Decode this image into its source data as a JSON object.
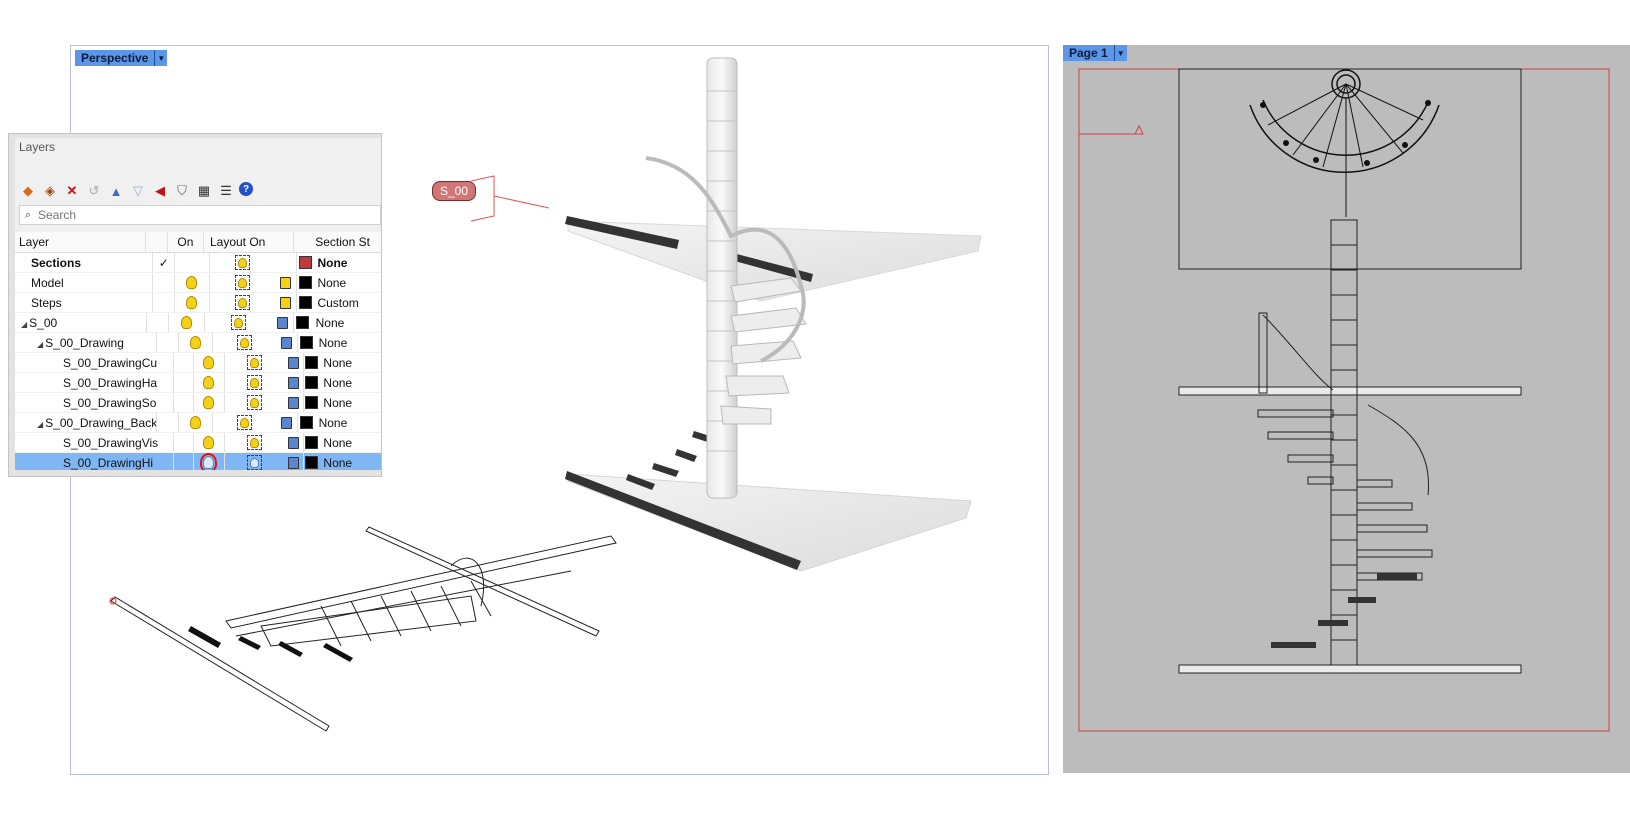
{
  "viewport": {
    "tab_label": "Perspective",
    "section_label": "S_00"
  },
  "layout": {
    "tab_label": "Page 1"
  },
  "layers_panel": {
    "title": "Layers",
    "search_placeholder": "Search",
    "columns": {
      "layer": "Layer",
      "on": "On",
      "layout_on": "Layout On",
      "section_style": "Section St"
    },
    "rows": [
      {
        "name": "Sections",
        "indent": 0,
        "bold": true,
        "current": true,
        "bulb": "none",
        "lock": "none",
        "color": "#c0393b",
        "section": "None",
        "section_bold": true
      },
      {
        "name": "Model",
        "indent": 0,
        "bold": false,
        "current": false,
        "bulb": "yellow",
        "lock": "open",
        "color": "#000000",
        "section": "None",
        "section_bold": false
      },
      {
        "name": "Steps",
        "indent": 0,
        "bold": false,
        "current": false,
        "bulb": "yellow",
        "lock": "open",
        "color": "#000000",
        "section": "Custom",
        "section_bold": false
      },
      {
        "name": "S_00",
        "indent": 0,
        "bold": false,
        "current": false,
        "bulb": "yellow",
        "lock": "locked",
        "color": "#000000",
        "section": "None",
        "section_bold": false,
        "expander": true
      },
      {
        "name": "S_00_Drawing",
        "indent": 1,
        "bold": false,
        "current": false,
        "bulb": "yellow",
        "lock": "locked",
        "color": "#000000",
        "section": "None",
        "section_bold": false,
        "expander": true
      },
      {
        "name": "S_00_DrawingCu",
        "indent": 2,
        "bold": false,
        "current": false,
        "bulb": "yellow",
        "lock": "locked",
        "color": "#000000",
        "section": "None",
        "section_bold": false
      },
      {
        "name": "S_00_DrawingHa",
        "indent": 2,
        "bold": false,
        "current": false,
        "bulb": "yellow",
        "lock": "locked",
        "color": "#000000",
        "section": "None",
        "section_bold": false
      },
      {
        "name": "S_00_DrawingSo",
        "indent": 2,
        "bold": false,
        "current": false,
        "bulb": "yellow",
        "lock": "locked",
        "color": "#000000",
        "section": "None",
        "section_bold": false
      },
      {
        "name": "S_00_Drawing_Back",
        "indent": 1,
        "bold": false,
        "current": false,
        "bulb": "yellow",
        "lock": "locked",
        "color": "#000000",
        "section": "None",
        "section_bold": false,
        "expander": true
      },
      {
        "name": "S_00_DrawingVis",
        "indent": 2,
        "bold": false,
        "current": false,
        "bulb": "yellow",
        "lock": "locked",
        "color": "#000000",
        "section": "None",
        "section_bold": false
      },
      {
        "name": "S_00_DrawingHi",
        "indent": 2,
        "bold": false,
        "current": false,
        "bulb": "off",
        "lock": "locked",
        "color": "#000000",
        "section": "None",
        "section_bold": false,
        "selected": true,
        "highlight": true
      }
    ]
  }
}
